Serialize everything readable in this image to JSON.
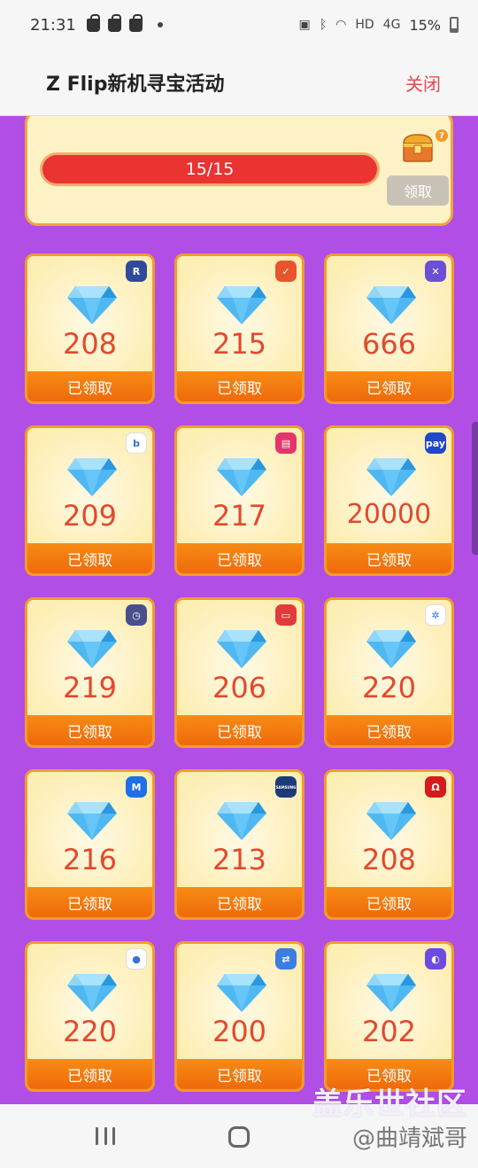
{
  "status_bar": {
    "time": "21:31",
    "network": "HD",
    "signal": "4G",
    "battery": "15%"
  },
  "header": {
    "title": "Z Flip新机寻宝活动",
    "close_label": "关闭"
  },
  "progress": {
    "current": 15,
    "total": 15,
    "text": "15/15",
    "claim_label": "领取"
  },
  "rewards": [
    {
      "value": "208",
      "status": "已领取",
      "app_icon": "samsung-rewards-icon",
      "icon_color": "#2e4a9a",
      "icon_glyph": "R"
    },
    {
      "value": "215",
      "status": "已领取",
      "app_icon": "reminder-icon",
      "icon_color": "#e8542b",
      "icon_glyph": "✓"
    },
    {
      "value": "666",
      "status": "已领取",
      "app_icon": "game-launcher-icon",
      "icon_color": "#6b4fd6",
      "icon_glyph": "✕"
    },
    {
      "value": "209",
      "status": "已领取",
      "app_icon": "bixby-icon",
      "icon_color": "#ffffff",
      "icon_glyph": "b"
    },
    {
      "value": "217",
      "status": "已领取",
      "app_icon": "galaxy-store-icon",
      "icon_color": "#e3356d",
      "icon_glyph": "▤"
    },
    {
      "value": "20000",
      "status": "已领取",
      "app_icon": "samsung-pay-icon",
      "icon_color": "#1f48c8",
      "icon_glyph": "pay"
    },
    {
      "value": "219",
      "status": "已领取",
      "app_icon": "clock-icon",
      "icon_color": "#4a4f8c",
      "icon_glyph": "◷"
    },
    {
      "value": "206",
      "status": "已领取",
      "app_icon": "wallet-icon",
      "icon_color": "#e33b3b",
      "icon_glyph": "▭"
    },
    {
      "value": "220",
      "status": "已领取",
      "app_icon": "smartthings-icon",
      "icon_color": "#ffffff",
      "icon_glyph": "✲"
    },
    {
      "value": "216",
      "status": "已领取",
      "app_icon": "samsung-members-icon",
      "icon_color": "#1c6fe8",
      "icon_glyph": "M"
    },
    {
      "value": "213",
      "status": "已领取",
      "app_icon": "samsung-mall-icon",
      "icon_color": "#1d3b78",
      "icon_glyph": "SAMSUNG"
    },
    {
      "value": "208",
      "status": "已领取",
      "app_icon": "music-headphones-icon",
      "icon_color": "#d41c1c",
      "icon_glyph": "Ω"
    },
    {
      "value": "220",
      "status": "已领取",
      "app_icon": "bixby-vision-icon",
      "icon_color": "#ffffff",
      "icon_glyph": "●"
    },
    {
      "value": "200",
      "status": "已领取",
      "app_icon": "smart-switch-icon",
      "icon_color": "#3b7de0",
      "icon_glyph": "⇄"
    },
    {
      "value": "202",
      "status": "已领取",
      "app_icon": "samsung-internet-icon",
      "icon_color": "#6e4be0",
      "icon_glyph": "◐"
    }
  ],
  "watermark": {
    "line1": "盖乐世社区",
    "line2": "@曲靖斌哥"
  }
}
